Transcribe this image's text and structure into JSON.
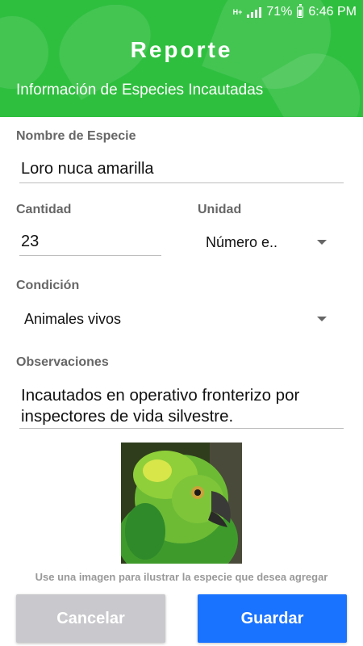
{
  "status_bar": {
    "network": "H+",
    "battery": "71%",
    "time": "6:46 PM"
  },
  "header": {
    "title": "Reporte",
    "subtitle": "Información de Especies Incautadas"
  },
  "form": {
    "species": {
      "label": "Nombre de Especie",
      "value": "Loro nuca amarilla"
    },
    "quantity": {
      "label": "Cantidad",
      "value": "23"
    },
    "unit": {
      "label": "Unidad",
      "value": "Número e.."
    },
    "condition": {
      "label": "Condición",
      "value": "Animales vivos"
    },
    "observations": {
      "label": "Observaciones",
      "line1": "Incautados en operativo fronterizo por",
      "line2": "inspectores de vida silvestre."
    }
  },
  "image_hint": "Use una imagen para ilustrar la especie que desea agregar",
  "buttons": {
    "cancel": "Cancelar",
    "save": "Guardar"
  },
  "colors": {
    "header": "#2fbf3f",
    "save_button": "#1a73ff",
    "cancel_button": "#c9c9cd"
  }
}
